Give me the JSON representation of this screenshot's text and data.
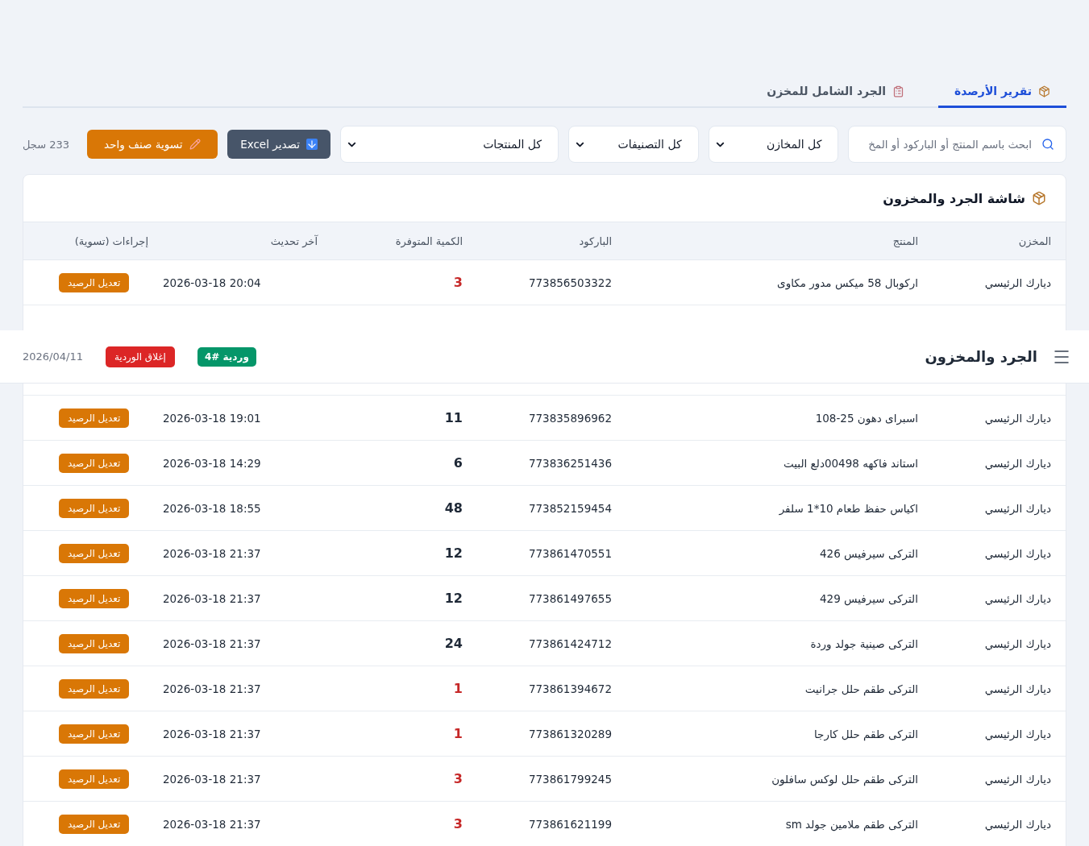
{
  "tabs": [
    {
      "label": "تقرير الأرصدة",
      "selected": true
    },
    {
      "label": "الجرد الشامل للمخزن",
      "selected": false
    }
  ],
  "toolbar": {
    "search": {
      "placeholder": "ابحث باسم المنتج أو الباركود أو المخ"
    },
    "filters": [
      "كل المخازن",
      "كل التصنيفات",
      "كل المنتجات"
    ],
    "export_button": "تصدير Excel",
    "adjust_button": "تسوية صنف واحد",
    "record_count": "233 سجل"
  },
  "card": {
    "title": "شاشة الجرد والمخزون",
    "columns": [
      "المخزن",
      "المنتج",
      "الباركود",
      "الكمية المتوفرة",
      "آخر تحديث",
      "إجراءات (تسوية)"
    ],
    "rows_before_header": [
      {
        "warehouse": "ديارك الرئيسي",
        "product": "اركوبال 58 ميكس مدور مكاوى",
        "barcode": "773856503322",
        "quantity": "3",
        "low": true,
        "updated": "2026-03-18 20:04",
        "action": "تعديل الرصيد"
      }
    ],
    "rows": [
      {
        "warehouse": "ديارك الرئيسي",
        "product": "اسبراى دهون 25-108",
        "barcode": "773835896962",
        "quantity": "11",
        "low": false,
        "updated": "2026-03-18 19:01",
        "action": "تعديل الرصيد"
      },
      {
        "warehouse": "ديارك الرئيسي",
        "product": "استاند فاكهه 00498دلع البيت",
        "barcode": "773836251436",
        "quantity": "6",
        "low": false,
        "updated": "2026-03-18 14:29",
        "action": "تعديل الرصيد"
      },
      {
        "warehouse": "ديارك الرئيسي",
        "product": "اكياس حفظ طعام 10*1 سلفر",
        "barcode": "773852159454",
        "quantity": "48",
        "low": false,
        "updated": "2026-03-18 18:55",
        "action": "تعديل الرصيد"
      },
      {
        "warehouse": "ديارك الرئيسي",
        "product": "التركى سيرفيس 426",
        "barcode": "773861470551",
        "quantity": "12",
        "low": false,
        "updated": "2026-03-18 21:37",
        "action": "تعديل الرصيد"
      },
      {
        "warehouse": "ديارك الرئيسي",
        "product": "التركى سيرفيس 429",
        "barcode": "773861497655",
        "quantity": "12",
        "low": false,
        "updated": "2026-03-18 21:37",
        "action": "تعديل الرصيد"
      },
      {
        "warehouse": "ديارك الرئيسي",
        "product": "التركى صينية جولد وردة",
        "barcode": "773861424712",
        "quantity": "24",
        "low": false,
        "updated": "2026-03-18 21:37",
        "action": "تعديل الرصيد"
      },
      {
        "warehouse": "ديارك الرئيسي",
        "product": "التركى طقم حلل جرانيت",
        "barcode": "773861394672",
        "quantity": "1",
        "low": true,
        "updated": "2026-03-18 21:37",
        "action": "تعديل الرصيد"
      },
      {
        "warehouse": "ديارك الرئيسي",
        "product": "التركى طقم حلل كارجا",
        "barcode": "773861320289",
        "quantity": "1",
        "low": true,
        "updated": "2026-03-18 21:37",
        "action": "تعديل الرصيد"
      },
      {
        "warehouse": "ديارك الرئيسي",
        "product": "التركى طقم حلل لوكس سافلون",
        "barcode": "773861799245",
        "quantity": "3",
        "low": true,
        "updated": "2026-03-18 21:37",
        "action": "تعديل الرصيد"
      },
      {
        "warehouse": "ديارك الرئيسي",
        "product": "التركى طقم ملامين جولد sm",
        "barcode": "773861621199",
        "quantity": "3",
        "low": true,
        "updated": "2026-03-18 21:37",
        "action": "تعديل الرصيد"
      }
    ]
  },
  "top_bar": {
    "title": "الجرد والمخزون",
    "shift_badge": "وردية #4",
    "close_shift_button": "إغلاق الوردية",
    "date": "2026/04/11"
  }
}
